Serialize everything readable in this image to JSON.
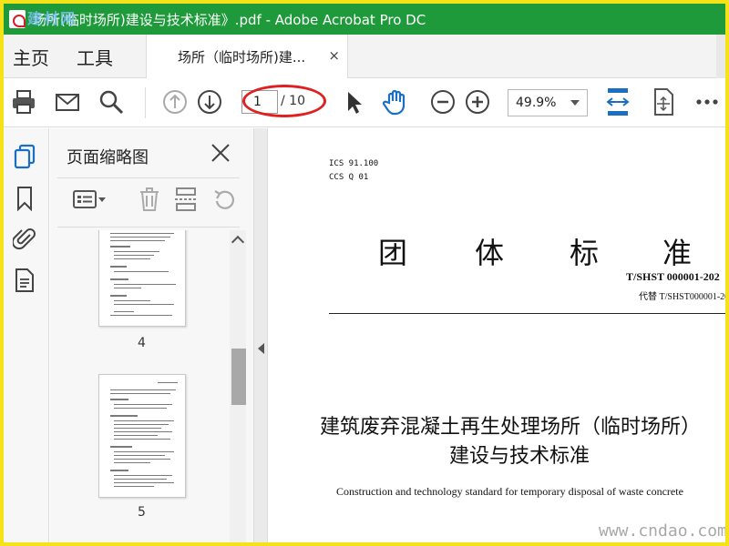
{
  "window": {
    "title": "场所(临时场所)建设与技术标准》.pdf - Adobe Acrobat Pro DC",
    "watermark_left": "建材网"
  },
  "menu": {
    "home": "主页",
    "tools": "工具",
    "doc_tab_label": "场所（临时场所)建...",
    "doc_tab_close": "×"
  },
  "toolbar": {
    "current_page": "1",
    "total_pages": "/ 10",
    "zoom": "49.9%"
  },
  "thumbnail_panel": {
    "title": "页面缩略图",
    "pages": [
      "4",
      "5"
    ]
  },
  "document": {
    "ics": "ICS 91.100",
    "ccs": "CCS Q 01",
    "standard_type_chars": [
      "团",
      "体",
      "标",
      "准"
    ],
    "standard_number": "T/SHST 000001-202",
    "replaces": "代替 T/SHST000001-20",
    "title_line1": "建筑废弃混凝土再生处理场所（临时场所）",
    "title_line2": "建设与技术标准",
    "english_title": "Construction and technology standard for temporary disposal of waste concrete"
  },
  "watermark": "www.cndao.com",
  "colors": {
    "titlebar": "#1e9a3a",
    "accent_blue": "#1a6fc4",
    "annotation_red": "#e02020",
    "frame_yellow": "#f5e31a"
  }
}
